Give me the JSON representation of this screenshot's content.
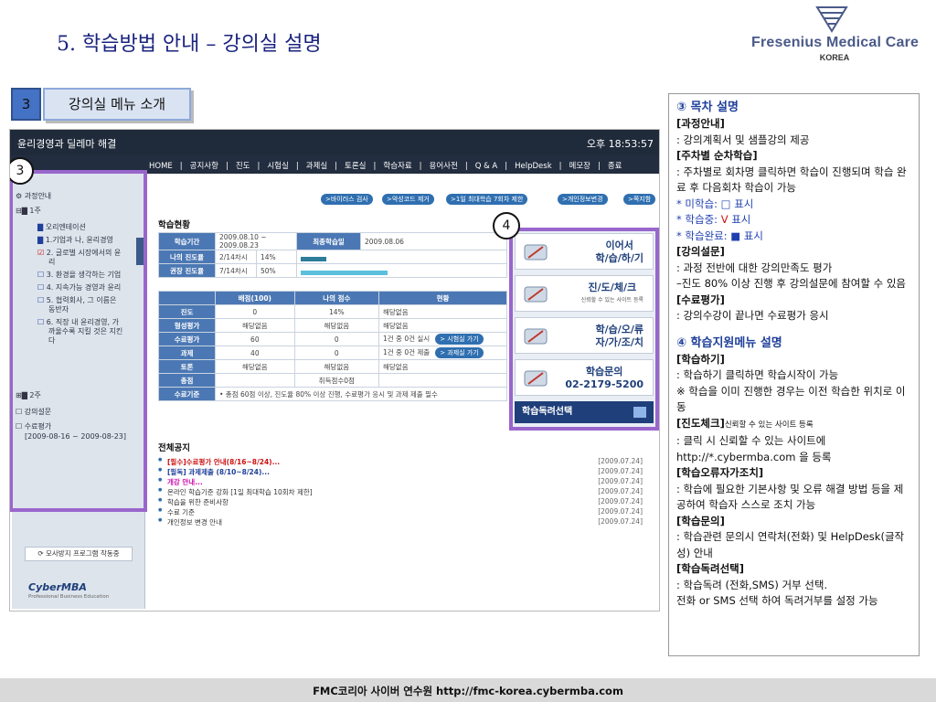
{
  "slide": {
    "title": "5. 학습방법 안내 – 강의실 설명",
    "logo": {
      "name": "Fresenius Medical Care",
      "sub": "KOREA",
      "brand_color": "#4a5a8a"
    },
    "section": {
      "number": "3",
      "label": "강의실 메뉴 소개"
    },
    "footer": "FMC코리아 사이버 연수원 http://fmc-korea.cybermba.com"
  },
  "screenshot": {
    "window_title": "윤리경영과 딜레마 해결",
    "clock": "오후 18:53:57",
    "nav_items": [
      "HOME",
      "|",
      "공지사항",
      "|",
      "진도",
      "|",
      "시험실",
      "|",
      "과제실",
      "|",
      "토론실",
      "|",
      "학습자료",
      "|",
      "용어사전",
      "|",
      "Q & A",
      "|",
      "HelpDesk",
      "|",
      "메모장",
      "|",
      "종료"
    ],
    "sidebar": {
      "root": "과정안내",
      "week1": "1주",
      "items": [
        "오리엔테이션",
        "1.기업과 나, 윤리경영",
        "2. 글로벌 시장에서의 윤",
        "리",
        "3. 환경을 생각하는 기업",
        "4. 지속가능 경영과 윤리",
        "5. 협력회사, 그 이름은",
        "동반자",
        "6. 직장 내 윤리경영, 가",
        "까울수록 지킬 것은 지킨",
        "다"
      ],
      "week2": "2주",
      "survey": "강의설문",
      "eval": "수료평가",
      "eval_period": "[2009-08-16 ~ 2009-08-23]",
      "tool_button": "모사방지 프로그램 작동중",
      "brand": "CyberMBA",
      "brand_sub": "Professional Business Education"
    },
    "pills": [
      ">바이러스 검사",
      ">악성코드 제거",
      ">1일 최대학습 7회차 제한",
      ">개인정보변경",
      ">쪽지함"
    ],
    "status_title": "학습현황",
    "status_table": {
      "period_label": "학습기간",
      "period_value": "2009.08.10 ~ 2009.08.23",
      "last_label": "최종학습일",
      "last_value": "2009.08.06",
      "progress_label": "나의 진도율",
      "progress_count": "2/14차시",
      "progress_pct": "14%",
      "progress_fraction": 0.14,
      "rec_label": "권장 진도율",
      "rec_count": "7/14차시",
      "rec_pct": "50%",
      "rec_fraction": 0.5
    },
    "score_table": {
      "headers": [
        "",
        "배점(100)",
        "나의 점수",
        "현황"
      ],
      "rows": [
        [
          "진도",
          "0",
          "14%",
          "해당없음"
        ],
        [
          "형성평가",
          "해당없음",
          "해당없음",
          "해당없음"
        ],
        [
          "수료평가",
          "60",
          "0",
          "1건 중 0건 실시"
        ],
        [
          "과제",
          "40",
          "0",
          "1건 중 0건 제출"
        ],
        [
          "토론",
          "해당없음",
          "해당없음",
          "해당없음"
        ],
        [
          "총점",
          "",
          "취득점수0점",
          ""
        ]
      ],
      "criteria_label": "수료기준",
      "criteria_text": "• 총점 60점 이상, 진도율 80% 이상 진행, 수료평가 응시 및 과제 제출 필수",
      "exam_button": "> 시험실 가기",
      "assign_button": "> 과제실 가기"
    },
    "notices_title": "전체공지",
    "notices": [
      {
        "text": "[필수]수료평가 안내(8/16~8/24)...",
        "date": "[2009.07.24]",
        "color": "#cc1111"
      },
      {
        "text": "[필독] 과제제출 (8/10~8/24)...",
        "date": "[2009.07.24]",
        "color": "#1f3f9a"
      },
      {
        "text": "개강 안내...",
        "date": "[2009.07.24]",
        "color": "#cc11aa"
      },
      {
        "text": "온라인 학습기준 강화 [1일 최대학습 10회차 제한]",
        "date": "[2009.07.24]",
        "color": "#333333"
      },
      {
        "text": "학습을 위한 준비사항",
        "date": "[2009.07.24]",
        "color": "#333333"
      },
      {
        "text": "수료 기준",
        "date": "[2009.07.24]",
        "color": "#333333"
      },
      {
        "text": "개인정보 변경 안내",
        "date": "[2009.07.24]",
        "color": "#333333"
      }
    ],
    "menu": [
      {
        "label1": "이어서",
        "label2": "학/습/하/기",
        "icon": "pencil-icon"
      },
      {
        "label1": "진/도/체/크",
        "label2": "신뢰할 수 있는 사이트 등록",
        "icon": "wrench-icon"
      },
      {
        "label1": "학/습/오/류",
        "label2": "자/가/조/치",
        "icon": "tools-icon"
      },
      {
        "label1": "학습문의",
        "label2": "02-2179-5200",
        "icon": "phone-icon"
      }
    ],
    "menu_bottom": "학습독려선택",
    "callout3": "3",
    "callout4": "4"
  },
  "panel": {
    "h1": "③ 목차 설명",
    "lines": [
      {
        "t": "[과정안내]",
        "c": "b"
      },
      {
        "t": ": 강의계획서 및 샘플강의 제공",
        "c": ""
      },
      {
        "t": "[주차별 순차학습]",
        "c": "b"
      },
      {
        "t": ": 주차별로 회차명 클릭하면 학습이 진행되며 학습 완료 후 다음회차 학습이 가능",
        "c": ""
      },
      {
        "t": "* 미학습: □ 표시",
        "c": "blue"
      },
      {
        "t": "* 학습중: ",
        "c": "blue",
        "extra": "V",
        "after": " 표시"
      },
      {
        "t": "* 학습완료: ■ 표시",
        "c": "blue"
      },
      {
        "t": "[강의설문]",
        "c": "b"
      },
      {
        "t": ": 과정 전반에 대한 강의만족도 평가",
        "c": ""
      },
      {
        "t": "–진도 80% 이상 진행 후 강의설문에 참여할 수 있음",
        "c": ""
      },
      {
        "t": "[수료평가]",
        "c": "b"
      },
      {
        "t": ": 강의수강이 끝나면 수료평가 응시",
        "c": ""
      }
    ],
    "h2": "④ 학습지원메뉴 설명",
    "lines2": [
      {
        "t": "[학습하기]",
        "c": "b"
      },
      {
        "t": ": 학습하기 클릭하면 학습시작이 가능",
        "c": ""
      },
      {
        "t": "※ 학습을 이미 진행한 경우는 이전 학습한 위치로 이동",
        "c": ""
      },
      {
        "t": "[진도체크]",
        "c": "b",
        "small": "신뢰할 수 있는 사이트 등록"
      },
      {
        "t": ": 클릭 시 신뢰할 수 있는 사이트에 http://*.cybermba.com 을 등록",
        "c": ""
      },
      {
        "t": "[학습오류자가조치]",
        "c": "b"
      },
      {
        "t": ": 학습에 필요한 기본사항 및 오류 해결 방법 등을 제공하여 학습자 스스로 조치 가능",
        "c": ""
      },
      {
        "t": "[학습문의]",
        "c": "b"
      },
      {
        "t": ": 학습관련 문의시 연락처(전화) 및 HelpDesk(글작성) 안내",
        "c": ""
      },
      {
        "t": "[학습독려선택]",
        "c": "b"
      },
      {
        "t": ": 학습독려 (전화,SMS) 거부 선택.",
        "c": ""
      },
      {
        "t": "전화 or SMS 선택 하여 독려거부를 설정 가능",
        "c": ""
      }
    ]
  }
}
